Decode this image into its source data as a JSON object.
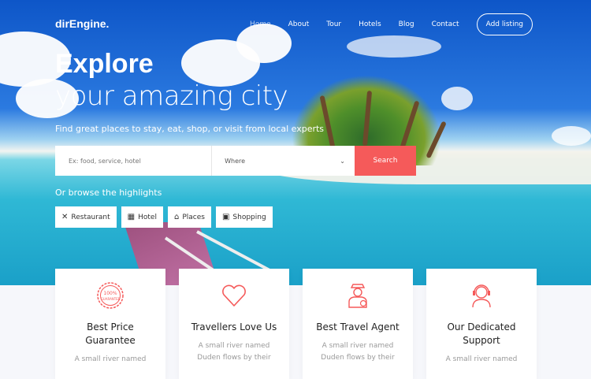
{
  "brand": {
    "logo": "dirEngine."
  },
  "nav": {
    "items": [
      {
        "label": "Home",
        "active": true
      },
      {
        "label": "About"
      },
      {
        "label": "Tour"
      },
      {
        "label": "Hotels"
      },
      {
        "label": "Blog"
      },
      {
        "label": "Contact"
      }
    ],
    "cta": "Add listing"
  },
  "hero": {
    "title_bold": "Explore",
    "title_light": "your amazing city",
    "subtitle": "Find great places to stay, eat, shop, or visit from local experts"
  },
  "search": {
    "what_placeholder": "Ex: food, service, hotel",
    "where_value": "Where",
    "button_label": "Search"
  },
  "browse": {
    "label": "Or browse the highlights",
    "chips": [
      {
        "label": "Restaurant",
        "icon": "cutlery-icon"
      },
      {
        "label": "Hotel",
        "icon": "hotel-icon"
      },
      {
        "label": "Places",
        "icon": "map-pin-icon"
      },
      {
        "label": "Shopping",
        "icon": "shopping-bag-icon"
      }
    ]
  },
  "features": [
    {
      "title": "Best Price Guarantee",
      "text": "A small river named",
      "icon": "guarantee-badge-icon",
      "badge_text": "100% GUARANTEE"
    },
    {
      "title": "Travellers Love Us",
      "text": "A small river named Duden flows by their",
      "icon": "heart-icon"
    },
    {
      "title": "Best Travel Agent",
      "text": "A small river named Duden flows by their",
      "icon": "agent-icon"
    },
    {
      "title": "Our Dedicated Support",
      "text": "A small river named",
      "icon": "headset-icon"
    }
  ],
  "colors": {
    "accent": "#f55a5a",
    "sky": "#1e6fd9",
    "sea": "#2fb8d5"
  }
}
